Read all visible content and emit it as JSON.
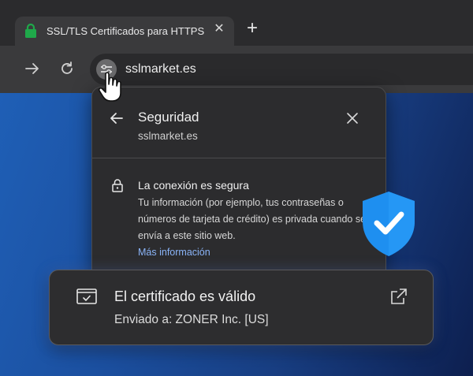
{
  "tab": {
    "title": "SSL/TLS Certificados para HTTPS",
    "lock_icon": "lock-icon",
    "lock_color": "#1fa84a",
    "close_icon": "close-icon"
  },
  "newtab_icon": "plus-icon",
  "toolbar": {
    "forward_icon": "forward-arrow-icon",
    "reload_icon": "reload-icon",
    "site_info_icon": "tune-icon",
    "url": "sslmarket.es"
  },
  "popup": {
    "title": "Seguridad",
    "site": "sslmarket.es",
    "connection_title": "La conexión es segura",
    "connection_desc": "Tu información (por ejemplo, tus contraseñas o números de tarjeta de crédito) es privada cuando se envía a este sitio web.",
    "more_link": "Más información",
    "link_color": "#8ab4f8"
  },
  "shield": {
    "icon": "check-shield-icon",
    "color": "#1e8ff0"
  },
  "certificate": {
    "title": "El certificado es válido",
    "issuer": "Enviado a: ZONER Inc. [US]",
    "icon": "certificate-icon",
    "open_icon": "open-external-icon"
  }
}
